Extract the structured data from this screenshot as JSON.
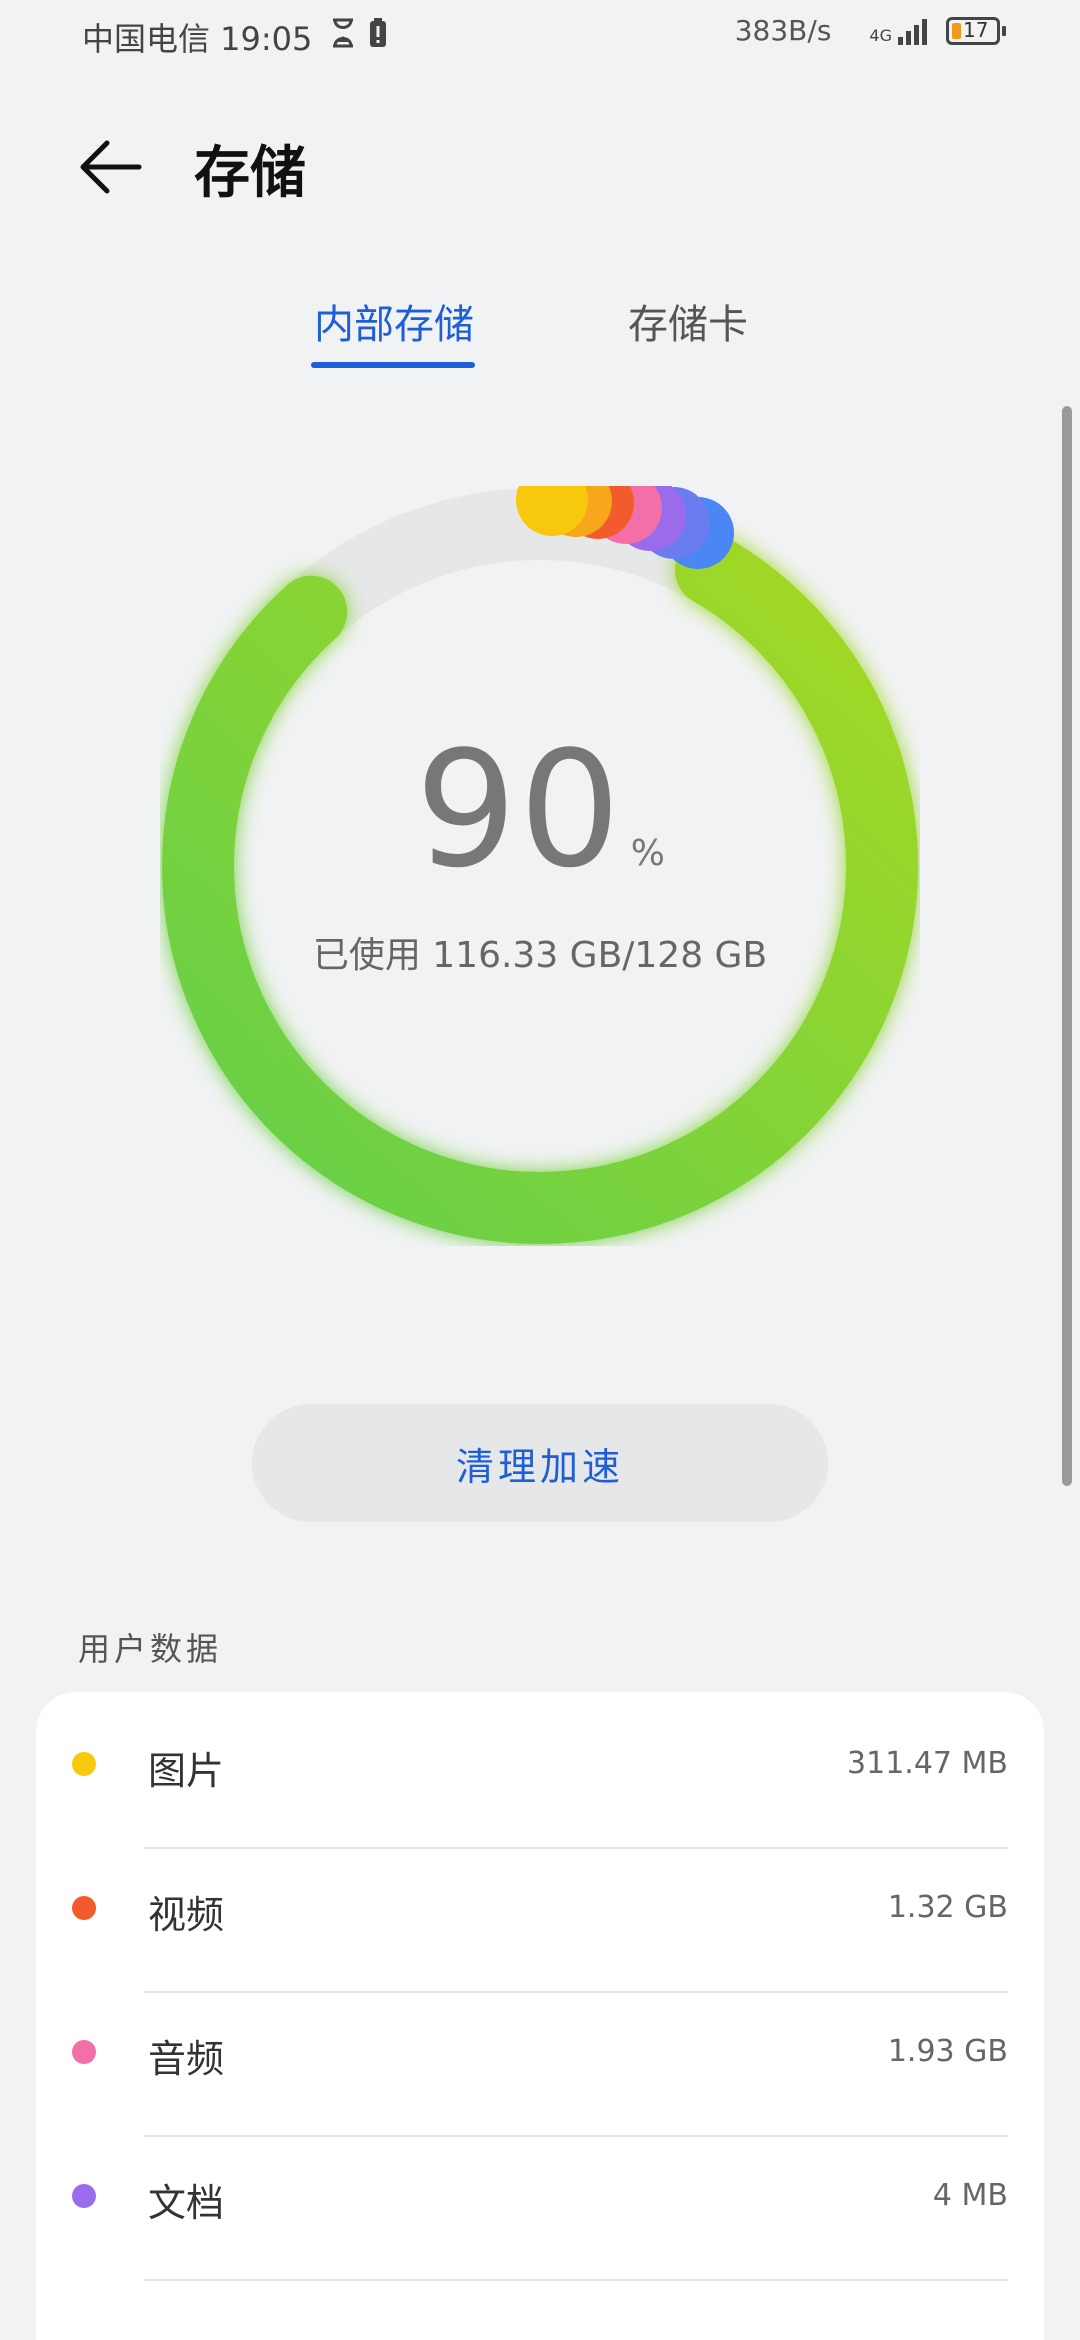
{
  "status_bar": {
    "carrier_time": "中国电信 19:05",
    "net_speed": "383B/s",
    "network": "4G",
    "battery": "17"
  },
  "header": {
    "title": "存储"
  },
  "tabs": {
    "internal": "内部存储",
    "card": "存储卡"
  },
  "storage": {
    "percent": "90",
    "percent_sign": "%",
    "used_text": "已使用 116.33 GB/128 GB",
    "used_fraction": 0.9
  },
  "colors": {
    "accent": "#1e5ed9",
    "ring_green_start": "#63cf4a",
    "ring_green_end": "#a5d824",
    "ring_track": "#e6e7e9"
  },
  "clean_button": {
    "label": "清理加速"
  },
  "user_data": {
    "label": "用户数据",
    "items": [
      {
        "name": "图片",
        "size": "311.47 MB",
        "color": "#f7c80c"
      },
      {
        "name": "视频",
        "size": "1.32 GB",
        "color": "#f25c2c"
      },
      {
        "name": "音频",
        "size": "1.93 GB",
        "color": "#f26fa8"
      },
      {
        "name": "文档",
        "size": "4 MB",
        "color": "#9a6cec"
      }
    ]
  }
}
